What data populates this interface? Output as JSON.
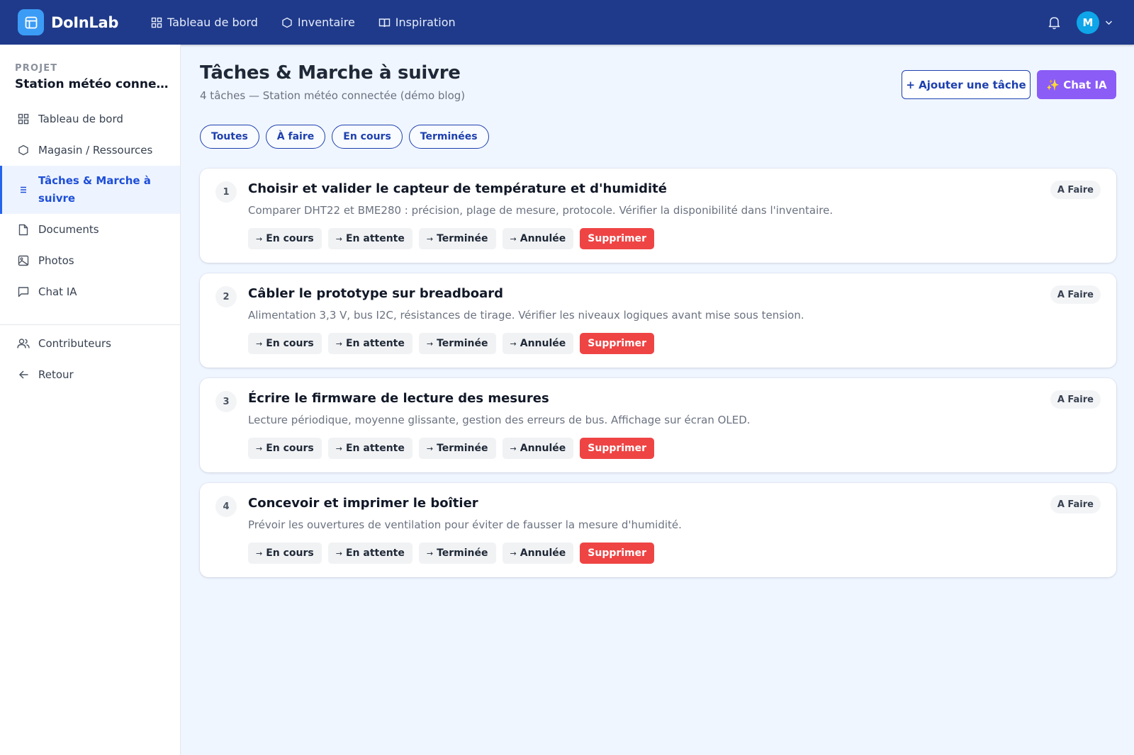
{
  "app": {
    "name": "DoInLab"
  },
  "topnav": [
    {
      "label": "Tableau de bord",
      "icon": "grid-icon"
    },
    {
      "label": "Inventaire",
      "icon": "hexagon-icon"
    },
    {
      "label": "Inspiration",
      "icon": "book-open-icon"
    }
  ],
  "user": {
    "initial": "M"
  },
  "sidebar": {
    "project_label": "PROJET",
    "project_name": "Station météo connectée (démo blog)",
    "items": [
      {
        "label": "Tableau de bord",
        "icon": "grid-icon"
      },
      {
        "label": "Magasin / Ressources",
        "icon": "hexagon-icon"
      },
      {
        "label": "Tâches & Marche à suivre",
        "icon": "list-icon",
        "active": true
      },
      {
        "label": "Documents",
        "icon": "file-icon"
      },
      {
        "label": "Photos",
        "icon": "image-icon"
      },
      {
        "label": "Chat IA",
        "icon": "message-icon"
      }
    ],
    "bottom_items": [
      {
        "label": "Contributeurs",
        "icon": "users-icon"
      },
      {
        "label": "Retour",
        "icon": "arrow-left-icon"
      }
    ]
  },
  "main": {
    "title": "Tâches & Marche à suivre",
    "subtitle": "4 tâches — Station météo connectée (démo blog)",
    "add_button": "+ Ajouter une tâche",
    "chat_button": "✨ Chat IA",
    "filters": [
      "Toutes",
      "À faire",
      "En cours",
      "Terminées"
    ],
    "tasks": [
      {
        "number": "1",
        "title": "Choisir et valider le capteur de température et d'humidité",
        "description": "Comparer DHT22 et BME280 : précision, plage de mesure, protocole. Vérifier la disponibilité dans l'inventaire.",
        "status": "A Faire"
      },
      {
        "number": "2",
        "title": "Câbler le prototype sur breadboard",
        "description": "Alimentation 3,3 V, bus I2C, résistances de tirage. Vérifier les niveaux logiques avant mise sous tension.",
        "status": "A Faire"
      },
      {
        "number": "3",
        "title": "Écrire le firmware de lecture des mesures",
        "description": "Lecture périodique, moyenne glissante, gestion des erreurs de bus. Affichage sur écran OLED.",
        "status": "A Faire"
      },
      {
        "number": "4",
        "title": "Concevoir et imprimer le boîtier",
        "description": "Prévoir les ouvertures de ventilation pour éviter de fausser la mesure d'humidité.",
        "status": "A Faire"
      }
    ],
    "actions": {
      "arrow": "→",
      "in_progress": "En cours",
      "waiting": "En attente",
      "done": "Terminée",
      "cancelled": "Annulée",
      "delete": "Supprimer"
    }
  },
  "colors": {
    "topbar": "#1f3a8a",
    "accent": "#1e40af",
    "chat": "#8b5cf6",
    "danger": "#ef4444",
    "avatar": "#0ea5e9"
  }
}
